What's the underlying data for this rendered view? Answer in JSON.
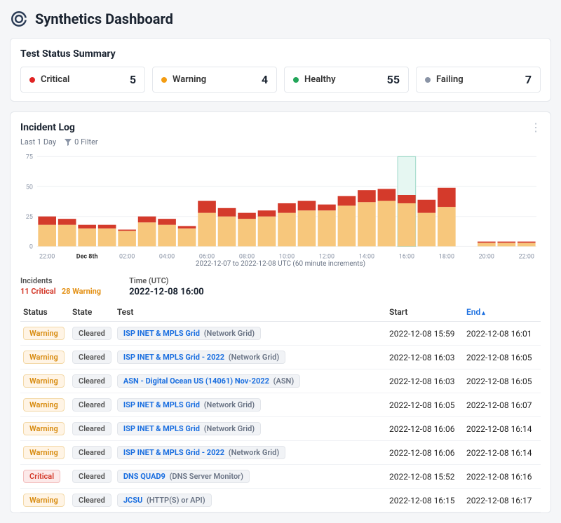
{
  "page_title": "Synthetics Dashboard",
  "summary": {
    "title": "Test Status Summary",
    "cards": [
      {
        "label": "Critical",
        "value": 5,
        "color": "red"
      },
      {
        "label": "Warning",
        "value": 4,
        "color": "orange"
      },
      {
        "label": "Healthy",
        "value": 55,
        "color": "green"
      },
      {
        "label": "Failing",
        "value": 7,
        "color": "gray"
      }
    ]
  },
  "incident": {
    "title": "Incident Log",
    "range_label": "Last 1 Day",
    "filter_label": "0 Filter",
    "chart_caption": "2022-12-07 to 2022-12-08 UTC (60 minute increments)",
    "summary_headers": {
      "incidents": "Incidents",
      "time": "Time (UTC)"
    },
    "summary_values": {
      "critical_count": "11 Critical",
      "warning_count": "28 Warning",
      "time": "2022-12-08 16:00"
    },
    "columns": {
      "status": "Status",
      "state": "State",
      "test": "Test",
      "start": "Start",
      "end": "End"
    },
    "rows": [
      {
        "status": "Warning",
        "state": "Cleared",
        "test": "ISP INET & MPLS Grid",
        "type": "Network Grid",
        "start": "2022-12-08 15:59",
        "end": "2022-12-08 16:01"
      },
      {
        "status": "Warning",
        "state": "Cleared",
        "test": "ISP INET & MPLS Grid - 2022",
        "type": "Network Grid",
        "start": "2022-12-08 16:03",
        "end": "2022-12-08 16:05"
      },
      {
        "status": "Warning",
        "state": "Cleared",
        "test": "ASN - Digital Ocean US (14061) Nov-2022",
        "type": "ASN",
        "start": "2022-12-08 16:03",
        "end": "2022-12-08 16:05"
      },
      {
        "status": "Warning",
        "state": "Cleared",
        "test": "ISP INET & MPLS Grid",
        "type": "Network Grid",
        "start": "2022-12-08 16:05",
        "end": "2022-12-08 16:07"
      },
      {
        "status": "Warning",
        "state": "Cleared",
        "test": "ISP INET & MPLS Grid",
        "type": "Network Grid",
        "start": "2022-12-08 16:06",
        "end": "2022-12-08 16:14"
      },
      {
        "status": "Warning",
        "state": "Cleared",
        "test": "ISP INET & MPLS Grid - 2022",
        "type": "Network Grid",
        "start": "2022-12-08 16:06",
        "end": "2022-12-08 16:14"
      },
      {
        "status": "Critical",
        "state": "Cleared",
        "test": "DNS QUAD9",
        "type": "DNS Server Monitor",
        "start": "2022-12-08 15:52",
        "end": "2022-12-08 16:16"
      },
      {
        "status": "Warning",
        "state": "Cleared",
        "test": "JCSU",
        "type": "HTTP(S) or API",
        "start": "2022-12-08 16:15",
        "end": "2022-12-08 16:17"
      }
    ]
  },
  "chart_data": {
    "type": "bar",
    "title": "Incident Log",
    "xlabel": "2022-12-07 to 2022-12-08 UTC (60 minute increments)",
    "ylabel": "",
    "ylim": [
      0,
      75
    ],
    "yticks": [
      0,
      25,
      50,
      75
    ],
    "xticks": [
      "22:00",
      "Dec 8th",
      "02:00",
      "04:00",
      "06:00",
      "08:00",
      "10:00",
      "12:00",
      "14:00",
      "16:00",
      "18:00",
      "20:00",
      "22:00"
    ],
    "categories": [
      "22:00",
      "23:00",
      "00:00",
      "01:00",
      "02:00",
      "03:00",
      "04:00",
      "05:00",
      "06:00",
      "07:00",
      "08:00",
      "09:00",
      "10:00",
      "11:00",
      "12:00",
      "13:00",
      "14:00",
      "15:00",
      "16:00",
      "17:00",
      "18:00",
      "19:00",
      "20:00",
      "21:00",
      "22:00"
    ],
    "series": [
      {
        "name": "Warning",
        "color": "#f7c77c",
        "values": [
          18,
          18,
          15,
          15,
          13,
          20,
          18,
          15,
          28,
          25,
          23,
          25,
          28,
          30,
          30,
          34,
          37,
          38,
          36,
          28,
          33,
          0,
          3,
          3,
          3
        ]
      },
      {
        "name": "Critical",
        "color": "#d43a2b",
        "values": [
          7,
          5,
          3,
          3,
          1,
          5,
          5,
          2,
          10,
          7,
          5,
          5,
          8,
          8,
          5,
          8,
          10,
          10,
          7,
          11,
          16,
          0,
          1,
          1,
          1
        ]
      }
    ],
    "selected_index": 18
  }
}
